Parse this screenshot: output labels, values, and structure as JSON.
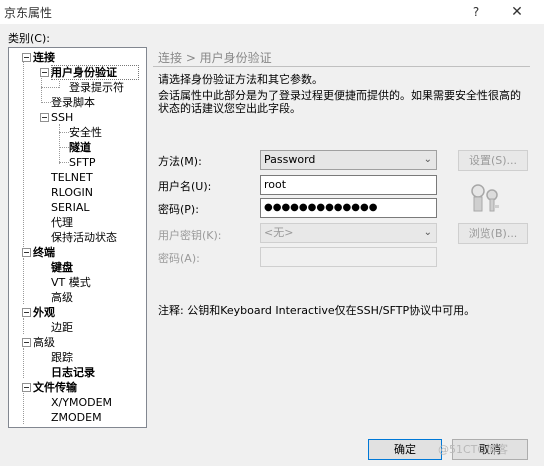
{
  "window": {
    "title": "京东属性",
    "help": "?",
    "close": "✕"
  },
  "category_label": "类别(C):",
  "tree": [
    {
      "label": "连接",
      "bold": true
    },
    {
      "label": "用户身份验证",
      "bold": true
    },
    {
      "label": "登录提示符",
      "bold": false
    },
    {
      "label": "登录脚本",
      "bold": false
    },
    {
      "label": "SSH",
      "bold": false
    },
    {
      "label": "安全性",
      "bold": false
    },
    {
      "label": "隧道",
      "bold": true
    },
    {
      "label": "SFTP",
      "bold": false
    },
    {
      "label": "TELNET",
      "bold": false
    },
    {
      "label": "RLOGIN",
      "bold": false
    },
    {
      "label": "SERIAL",
      "bold": false
    },
    {
      "label": "代理",
      "bold": false
    },
    {
      "label": "保持活动状态",
      "bold": false
    },
    {
      "label": "终端",
      "bold": true
    },
    {
      "label": "键盘",
      "bold": true
    },
    {
      "label": "VT 模式",
      "bold": false
    },
    {
      "label": "高级",
      "bold": false
    },
    {
      "label": "外观",
      "bold": true
    },
    {
      "label": "边距",
      "bold": false
    },
    {
      "label": "高级",
      "bold": false
    },
    {
      "label": "跟踪",
      "bold": false
    },
    {
      "label": "日志记录",
      "bold": true
    },
    {
      "label": "文件传输",
      "bold": true
    },
    {
      "label": "X/YMODEM",
      "bold": false
    },
    {
      "label": "ZMODEM",
      "bold": false
    }
  ],
  "panel": {
    "breadcrumb": "连接 > 用户身份验证",
    "desc1": "请选择身份验证方法和其它参数。",
    "desc2": "会话属性中此部分是为了登录过程更便捷而提供的。如果需要安全性很高的状态的话建议您空出此字段。",
    "method_label": "方法(M):",
    "method_value": "Password",
    "settings_button": "设置(S)...",
    "username_label": "用户名(U):",
    "username_value": "root",
    "password_label": "密码(P):",
    "password_value": "●●●●●●●●●●●●●",
    "userkey_label": "用户密钥(K):",
    "userkey_value": "<无>",
    "browse_button": "浏览(B)...",
    "passphrase_label": "密码(A):",
    "note": "注释: 公钥和Keyboard Interactive仅在SSH/SFTP协议中可用。"
  },
  "footer": {
    "ok": "确定",
    "cancel": "取消",
    "watermark": "@51CTO博客"
  }
}
